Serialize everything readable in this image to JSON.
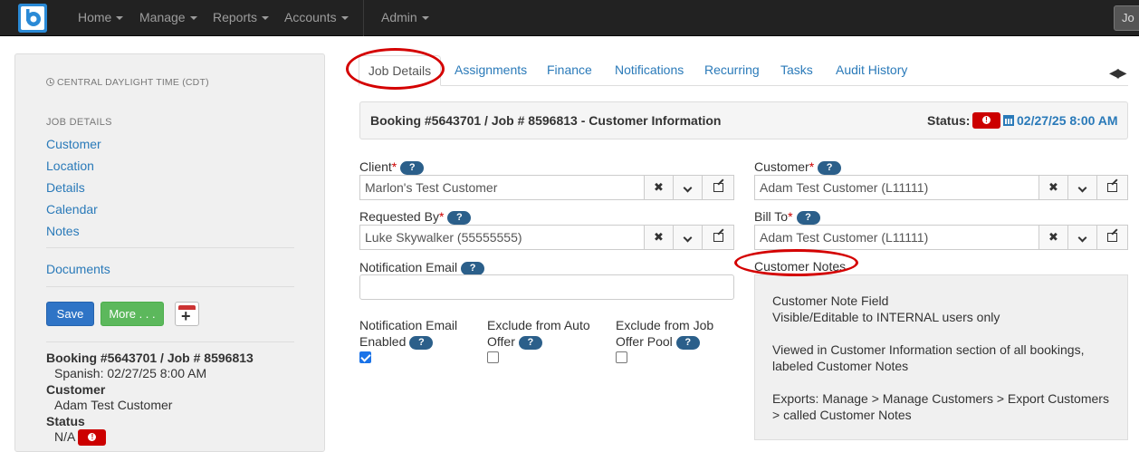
{
  "nav": {
    "items": [
      {
        "label": "Home"
      },
      {
        "label": "Manage"
      },
      {
        "label": "Reports"
      },
      {
        "label": "Accounts"
      },
      {
        "label": "Admin"
      }
    ],
    "right_button": "Jo"
  },
  "sidebar": {
    "timezone": "CENTRAL DAYLIGHT TIME (CDT)",
    "heading": "JOB DETAILS",
    "links": [
      "Customer",
      "Location",
      "Details",
      "Calendar",
      "Notes"
    ],
    "documents": "Documents",
    "save": "Save",
    "more": "More . . .",
    "summary": {
      "booking": "Booking #5643701 / Job # 8596813",
      "spanish": "Spanish: 02/27/25 8:00 AM",
      "customer_label": "Customer",
      "customer_value": "Adam Test Customer",
      "status_label": "Status",
      "status_value": "N/A"
    }
  },
  "tabs": [
    "Job Details",
    "Assignments",
    "Finance",
    "Notifications",
    "Recurring",
    "Tasks",
    "Audit History"
  ],
  "panel": {
    "title": "Booking #5643701 / Job # 8596813 - Customer Information",
    "status_label": "Status:",
    "status_date": "02/27/25 8:00 AM"
  },
  "form": {
    "client_label": "Client",
    "client_value": "Marlon's Test Customer",
    "requested_by_label": "Requested By",
    "requested_by_value": "Luke Skywalker (55555555)",
    "notification_email_label": "Notification Email",
    "notification_email_value": "",
    "notif_enabled_label_1": "Notification Email",
    "notif_enabled_label_2": "Enabled",
    "notif_enabled": true,
    "exclude_auto_label_1": "Exclude from Auto",
    "exclude_auto_label_2": "Offer",
    "exclude_auto": false,
    "exclude_pool_label_1": "Exclude from Job",
    "exclude_pool_label_2": "Offer Pool",
    "exclude_pool": false,
    "customer_label": "Customer",
    "customer_value": "Adam Test Customer (L11111)",
    "bill_to_label": "Bill To",
    "bill_to_value": "Adam Test Customer (L11111)",
    "customer_notes_label": "Customer Notes",
    "help": "?",
    "required_mark": "*"
  },
  "notes": {
    "line1": "Customer Note Field",
    "line2": "Visible/Editable to INTERNAL users only",
    "line3": "Viewed in Customer Information section of all bookings, labeled Customer Notes",
    "line4": "Exports: Manage > Manage Customers > Export Customers > called Customer Notes"
  },
  "colors": {
    "navbar": "#222222",
    "link": "#2a7ab9",
    "annotation": "#d40000",
    "status_badge": "#cc0000"
  }
}
